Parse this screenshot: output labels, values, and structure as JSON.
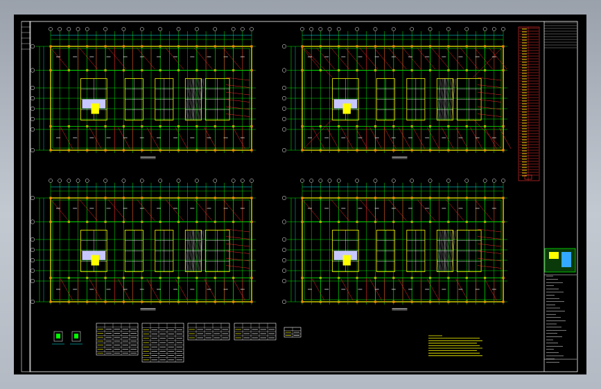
{
  "viewer": {
    "background": "#000000",
    "frame_color": "#ffffff"
  },
  "colors": {
    "axis": "#ffffff",
    "grid": "#00ff00",
    "wall": "#ffff00",
    "beam": "#ff2a2a",
    "dim": "#00ffff",
    "core": "#ffff00",
    "note": "#ffff00",
    "title_block": "#00ff00"
  },
  "plans": [
    {
      "id": "plan-top-left",
      "caption": ""
    },
    {
      "id": "plan-top-right",
      "caption": ""
    },
    {
      "id": "plan-bottom-left",
      "caption": ""
    },
    {
      "id": "plan-bottom-right",
      "caption": ""
    }
  ],
  "title_block": {
    "logo": "green-yellow-stamp"
  },
  "tables": [
    {
      "id": "schedule-1"
    },
    {
      "id": "schedule-2"
    },
    {
      "id": "schedule-3"
    },
    {
      "id": "schedule-4"
    },
    {
      "id": "legend-small"
    }
  ],
  "notes": {
    "id": "yellow-notes"
  },
  "column_schedule": {
    "id": "red-column-list"
  },
  "details": {
    "id": "section-details"
  }
}
